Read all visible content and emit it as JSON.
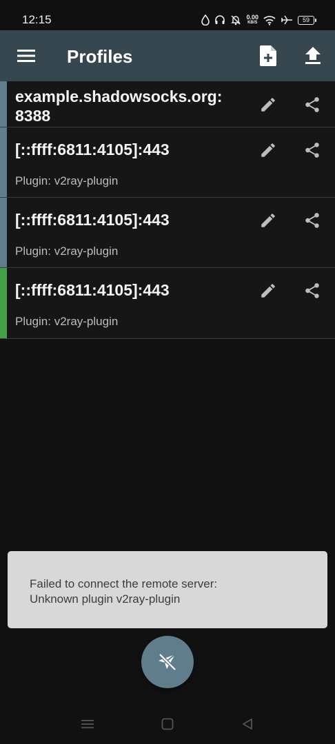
{
  "status_bar": {
    "time": "12:15",
    "net_speed_value": "0.00",
    "net_speed_unit": "KB/S",
    "battery_level": "59",
    "icons": [
      "water-drop-icon",
      "headset-icon",
      "bell-off-icon",
      "net-speed",
      "wifi-icon",
      "airplane-icon",
      "battery-icon"
    ]
  },
  "app_bar": {
    "title": "Profiles",
    "icons": {
      "menu": "menu-icon",
      "add": "add-file-icon",
      "upload": "upload-icon"
    }
  },
  "profiles": [
    {
      "name": "example.shadowsocks.org: 8388",
      "subtitle": "",
      "active": false
    },
    {
      "name": "[::ffff:6811:4105]:443",
      "subtitle": "Plugin: v2ray-plugin",
      "active": false
    },
    {
      "name": "[::ffff:6811:4105]:443",
      "subtitle": "Plugin: v2ray-plugin",
      "active": false
    },
    {
      "name": "[::ffff:6811:4105]:443",
      "subtitle": "Plugin: v2ray-plugin",
      "active": true
    }
  ],
  "snackbar": {
    "line1": "Failed to connect the remote server:",
    "line2": "Unknown plugin v2ray-plugin"
  },
  "fab": {
    "icon": "plane-off-icon"
  },
  "nav_bar": {
    "icons": [
      "recents-icon",
      "home-icon",
      "back-icon"
    ]
  },
  "colors": {
    "app_bar": "#37474f",
    "indicator_inactive": "#607d8b",
    "indicator_active": "#43a047",
    "fab": "#607d8b",
    "snackbar_bg": "#d8d8d8"
  }
}
